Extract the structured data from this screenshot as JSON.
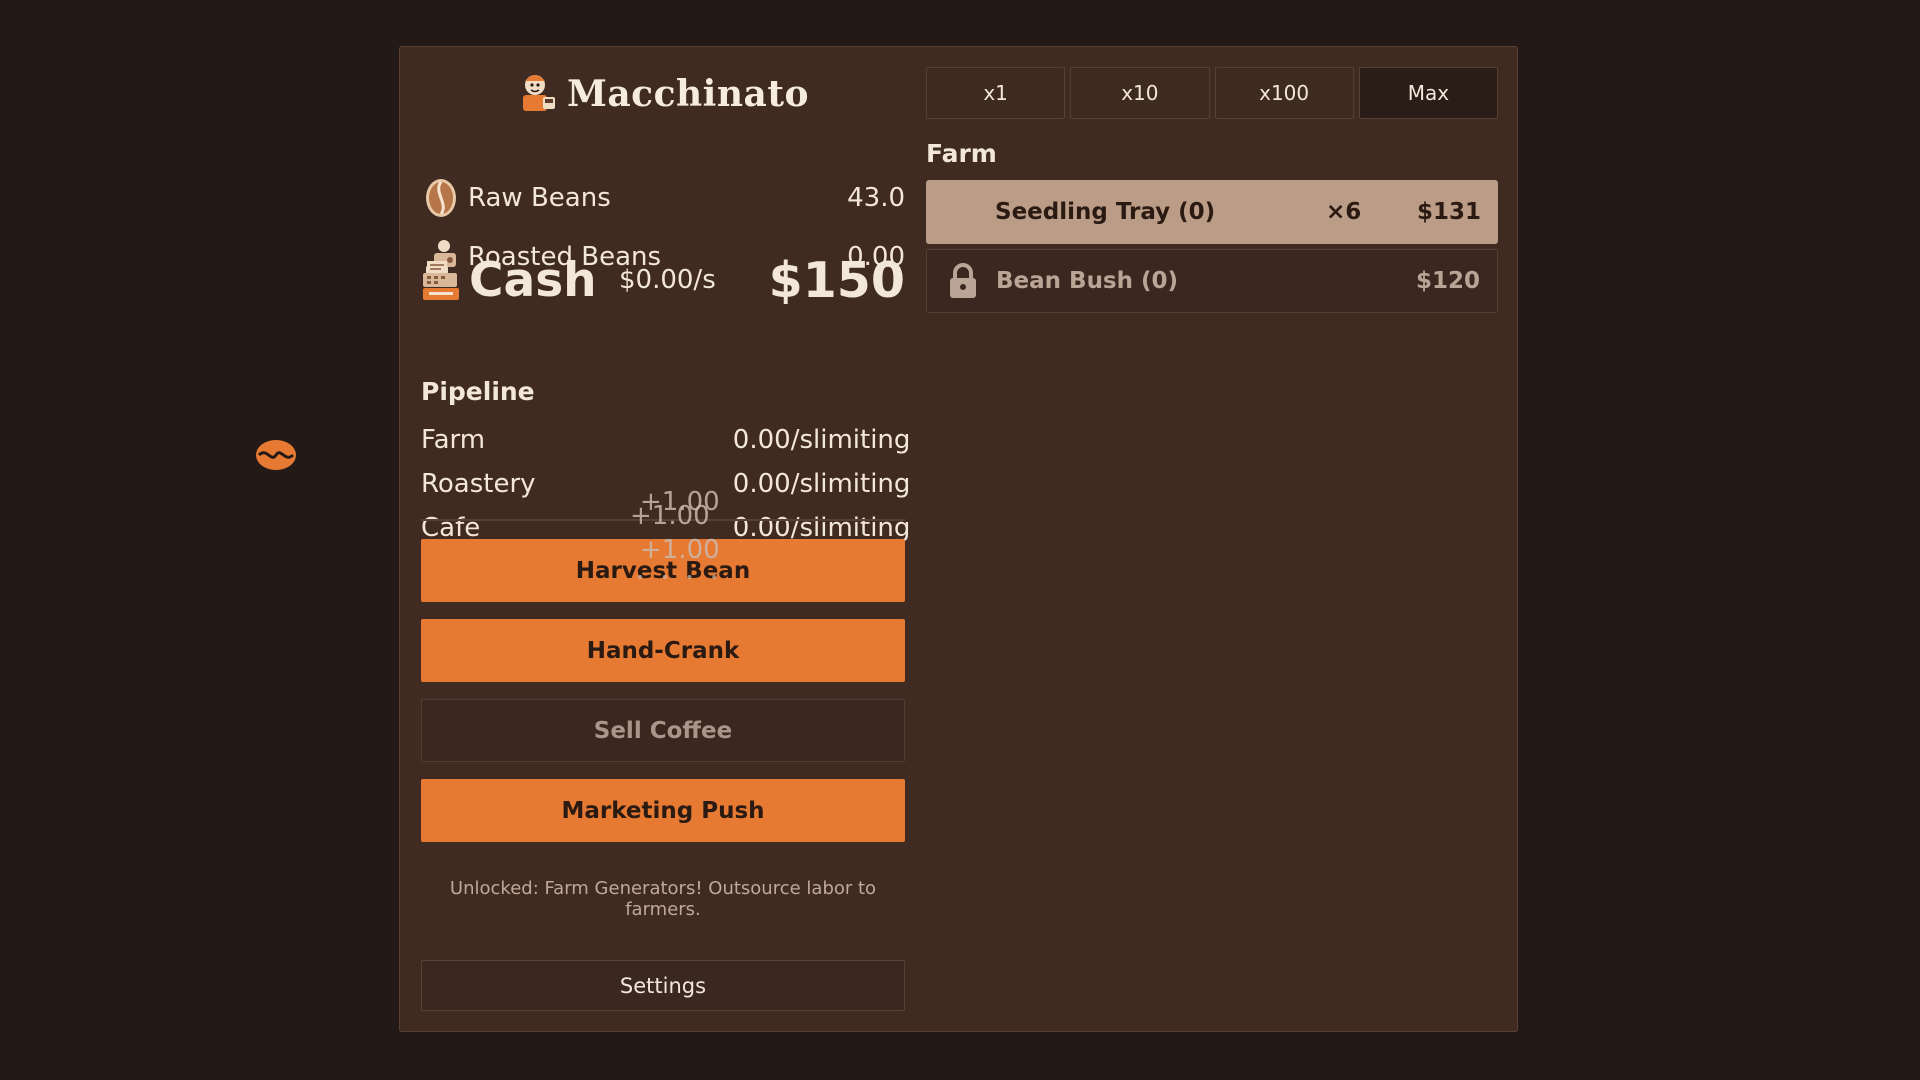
{
  "app": {
    "title": "Macchinato"
  },
  "resources": {
    "raw_beans": {
      "label": "Raw Beans",
      "value": "43.0",
      "icon": "coffee-bean-icon"
    },
    "roasted_beans": {
      "label": "Roasted Beans",
      "value": "0.00",
      "icon": "roaster-icon"
    }
  },
  "cash": {
    "label": "Cash",
    "rate": "$0.00/s",
    "value": "$150",
    "icon": "cash-register-icon"
  },
  "pipeline": {
    "title": "Pipeline",
    "rows": [
      {
        "name": "Farm",
        "rate": "0.00/s",
        "status": "limiting"
      },
      {
        "name": "Roastery",
        "rate": "0.00/s",
        "status": "limiting"
      },
      {
        "name": "Cafe",
        "rate": "0.00/s",
        "status": "limiting"
      }
    ]
  },
  "floating": [
    "+1.00",
    "+1.00",
    "+1.00"
  ],
  "actions": {
    "harvest": "Harvest Bean",
    "hand_crank": "Hand-Crank",
    "sell": "Sell Coffee",
    "marketing": "Marketing Push"
  },
  "notice": "Unlocked: Farm Generators! Outsource labor to farmers.",
  "settings_label": "Settings",
  "multipliers": {
    "items": [
      "x1",
      "x10",
      "x100",
      "Max"
    ],
    "active": "Max"
  },
  "farm": {
    "title": "Farm",
    "generators": [
      {
        "name": "Seedling Tray (0)",
        "multiplier": "×6",
        "cost": "$131",
        "state": "affordable"
      },
      {
        "name": "Bean Bush (0)",
        "multiplier": "",
        "cost": "$120",
        "state": "locked",
        "icon": "lock-icon"
      }
    ]
  },
  "colors": {
    "accent": "#e67a33",
    "background": "#231a17",
    "panel": "#3f2b22",
    "affordable": "#bb9c87"
  }
}
